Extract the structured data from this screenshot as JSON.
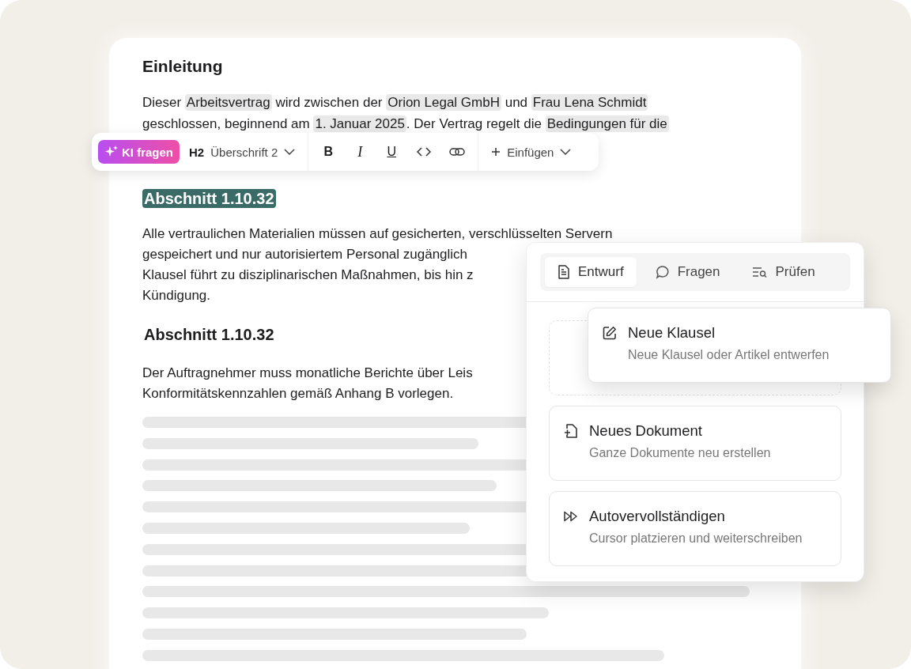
{
  "document": {
    "title": "Einleitung",
    "intro_lines": [
      [
        {
          "text": "Dieser ",
          "highlighted": false
        },
        {
          "text": "Arbeitsvertrag",
          "highlighted": true
        },
        {
          "text": " wird zwischen der ",
          "highlighted": false
        },
        {
          "text": "Orion Legal GmbH",
          "highlighted": true
        },
        {
          "text": " und ",
          "highlighted": false
        },
        {
          "text": "Frau Lena Schmidt",
          "highlighted": true
        }
      ],
      [
        {
          "text": "geschlossen, beginnend am ",
          "highlighted": false
        },
        {
          "text": "1. Januar 2025",
          "highlighted": true
        },
        {
          "text": ". Der Vertrag regelt die ",
          "highlighted": false
        },
        {
          "text": "Bedingungen für die",
          "highlighted": true
        }
      ]
    ],
    "sections": [
      {
        "heading": "Abschnitt 1.10.32",
        "selected": true,
        "lines": [
          "Alle vertraulichen Materialien müssen auf gesicherten, verschlüsselten Servern",
          "gespeichert und nur autorisiertem Personal zugänglich",
          "Klausel führt zu disziplinarischen Maßnahmen, bis hin z",
          "Kündigung."
        ]
      },
      {
        "heading": "Abschnitt 1.10.32",
        "selected": false,
        "lines": [
          "Der Auftragnehmer muss monatliche Berichte über Leis",
          "Konformitätskennzahlen gemäß Anhang B vorlegen."
        ]
      }
    ]
  },
  "toolbar": {
    "ai_button": "KI fragen",
    "heading_level": "H2",
    "heading_style": "Überschrift 2",
    "bold": "B",
    "italic": "I",
    "underline": "U",
    "insert": "Einfügen"
  },
  "panel": {
    "tabs": [
      {
        "label": "Entwurf",
        "selected": true
      },
      {
        "label": "Fragen",
        "selected": false
      },
      {
        "label": "Prüfen",
        "selected": false
      }
    ],
    "cards": [
      {
        "title": "Neue Klausel",
        "description": "Neue Klausel oder Artikel entwerfen",
        "lifted": true
      },
      {
        "title": "Neues Dokument",
        "description": "Ganze Dokumente neu erstellen",
        "lifted": false
      },
      {
        "title": "Autovervollständigen",
        "description": "Cursor platzieren und weiterschreiben",
        "lifted": false
      }
    ]
  }
}
